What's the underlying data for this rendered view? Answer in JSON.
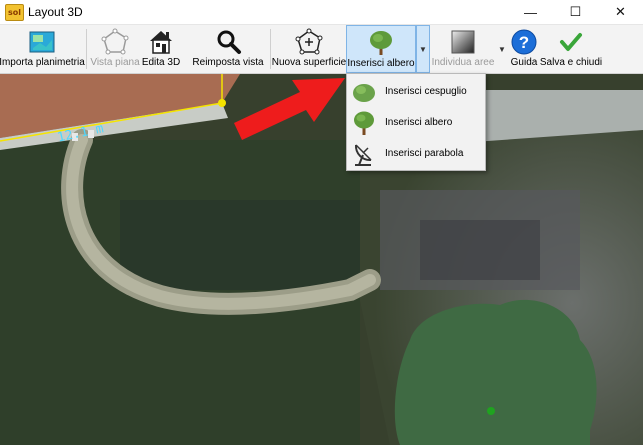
{
  "window": {
    "app_icon_text": "sol",
    "title": "Layout 3D",
    "minimize": "—",
    "maximize": "☐",
    "close": "✕"
  },
  "toolbar": {
    "import_plan": "Importa planimetria",
    "plan_view": "Vista piana",
    "edit_3d": "Edita 3D",
    "reset_view": "Reimposta vista",
    "new_surface": "Nuova superficie",
    "insert_tree": "Inserisci albero",
    "identify_areas": "Individua aree",
    "guide": "Guida",
    "save_close": "Salva e chiudi"
  },
  "dropdown_menu": {
    "items": [
      {
        "label": "Inserisci cespuglio",
        "icon": "bush-icon"
      },
      {
        "label": "Inserisci albero",
        "icon": "tree-icon"
      },
      {
        "label": "Inserisci parabola",
        "icon": "satellite-dish-icon"
      }
    ]
  },
  "map": {
    "dimension_label": "12.1 m"
  },
  "colors": {
    "toolbar_active": "#cfe6fa",
    "annotation_arrow": "#ee1c1c",
    "outline": "#f5e400",
    "tree_fill": "#3f6a43"
  }
}
